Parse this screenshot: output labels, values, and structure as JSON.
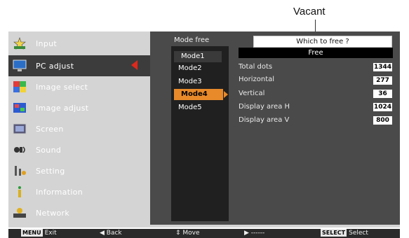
{
  "callout": {
    "label": "Vacant"
  },
  "left_menu": {
    "items": [
      {
        "label": "Input",
        "icon": "input-icon"
      },
      {
        "label": "PC adjust",
        "icon": "pc-adjust-icon",
        "selected": true
      },
      {
        "label": "Image select",
        "icon": "image-select-icon"
      },
      {
        "label": "Image adjust",
        "icon": "image-adjust-icon"
      },
      {
        "label": "Screen",
        "icon": "screen-icon"
      },
      {
        "label": "Sound",
        "icon": "sound-icon"
      },
      {
        "label": "Setting",
        "icon": "setting-icon"
      },
      {
        "label": "Information",
        "icon": "information-icon"
      },
      {
        "label": "Network",
        "icon": "network-icon"
      }
    ]
  },
  "mode_panel": {
    "mode_free_label": "Mode free",
    "mode_free_question": "Which to free ?",
    "modes": [
      "Mode1",
      "Mode2",
      "Mode3",
      "Mode4",
      "Mode5"
    ],
    "highlighted_mode": "Mode4"
  },
  "free_panel": {
    "header": "Free",
    "params": [
      {
        "label": "Total dots",
        "value": "1344"
      },
      {
        "label": "Horizontal",
        "value": "277"
      },
      {
        "label": "Vertical",
        "value": "36"
      },
      {
        "label": "Display area H",
        "value": "1024"
      },
      {
        "label": "Display area V",
        "value": "800"
      }
    ]
  },
  "bottom_bar": {
    "exit_key": "MENU",
    "exit_label": "Exit",
    "back_label": "Back",
    "move_label": "Move",
    "next_label": "------",
    "select_key": "SELECT",
    "select_label": "Select"
  },
  "colors": {
    "panel_bg": "#d4d4d4",
    "selected_item_bg": "#3c3c3c",
    "highlight": "#e88a2a",
    "arrow": "#e0281c"
  }
}
